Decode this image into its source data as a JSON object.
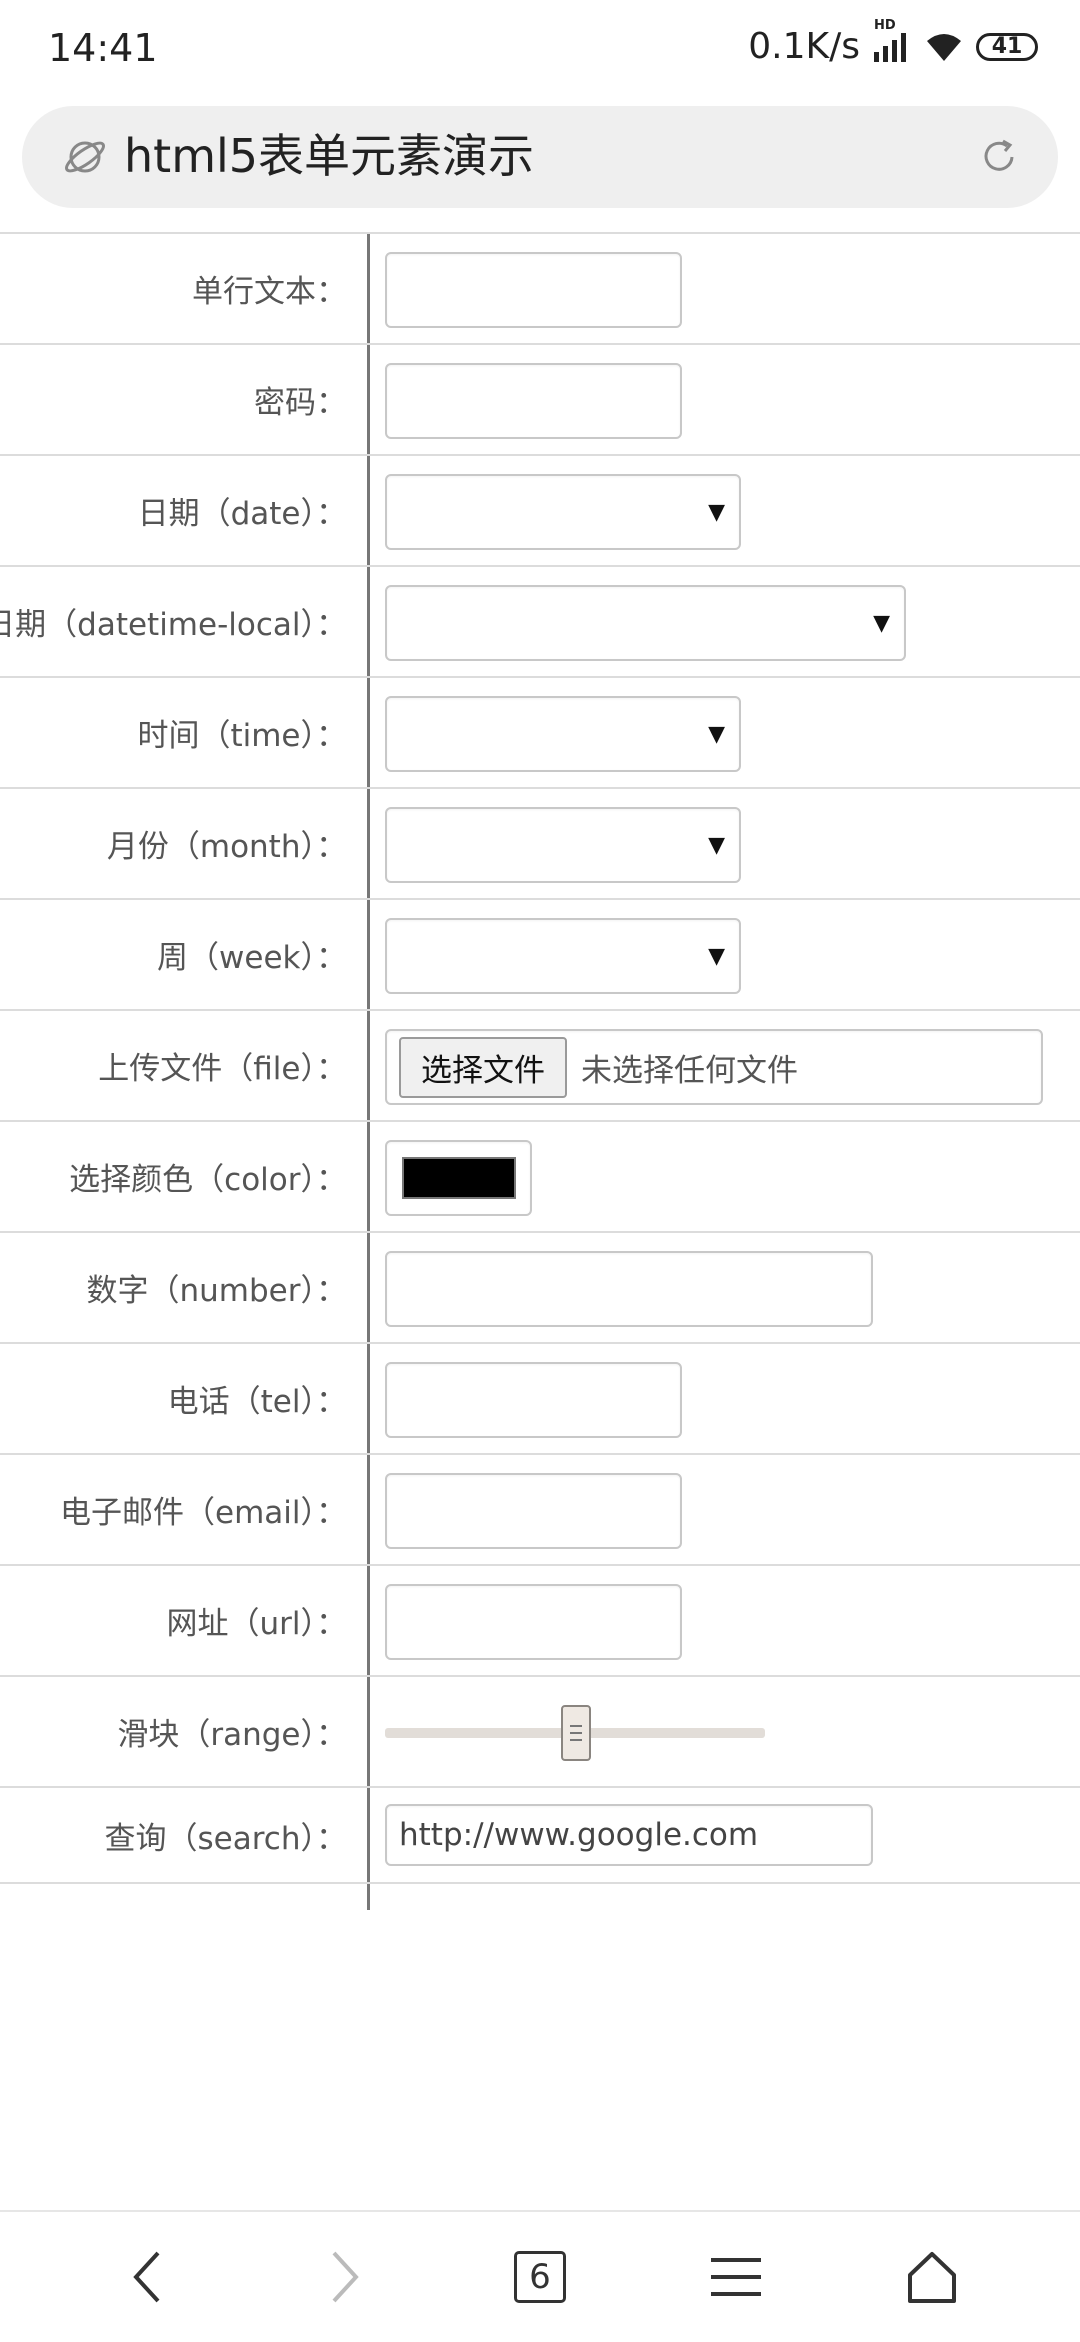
{
  "status_bar": {
    "time": "14:41",
    "net_speed": "0.1K/s",
    "network_badge": "HD",
    "battery": "41",
    "icons": [
      "signal-icon",
      "wifi-icon",
      "battery-icon"
    ]
  },
  "address_bar": {
    "title": "html5表单元素演示",
    "icons": [
      "planet-icon",
      "reload-icon"
    ]
  },
  "form": {
    "rows": [
      {
        "label": "单行文本：",
        "type": "text",
        "value": ""
      },
      {
        "label": "密码：",
        "type": "password",
        "value": ""
      },
      {
        "label": "日期（date）：",
        "type": "date",
        "value": ""
      },
      {
        "label": "日期（datetime-local）：",
        "type": "datetime-local",
        "value": ""
      },
      {
        "label": "时间（time）：",
        "type": "time",
        "value": ""
      },
      {
        "label": "月份（month）：",
        "type": "month",
        "value": ""
      },
      {
        "label": "周（week）：",
        "type": "week",
        "value": ""
      },
      {
        "label": "上传文件（file）：",
        "type": "file",
        "button": "选择文件",
        "status": "未选择任何文件"
      },
      {
        "label": "选择颜色（color）：",
        "type": "color",
        "value": "#000000"
      },
      {
        "label": "数字（number）：",
        "type": "number",
        "value": ""
      },
      {
        "label": "电话（tel）：",
        "type": "tel",
        "value": ""
      },
      {
        "label": "电子邮件（email）：",
        "type": "email",
        "value": ""
      },
      {
        "label": "网址（url）：",
        "type": "url",
        "value": ""
      },
      {
        "label": "滑块（range）：",
        "type": "range",
        "value": 0.5
      },
      {
        "label": "查询（search）：",
        "type": "search",
        "value": "http://www.google.com"
      }
    ],
    "dropdown_arrow": "▼"
  },
  "bottom_nav": {
    "tabs_count": "6",
    "icons": [
      "back-icon",
      "forward-icon",
      "tabs-icon",
      "menu-icon",
      "home-icon"
    ]
  },
  "colors": {
    "address_bg": "#efefef",
    "divider": "#dcdcdc",
    "color_swatch": "#000000"
  }
}
